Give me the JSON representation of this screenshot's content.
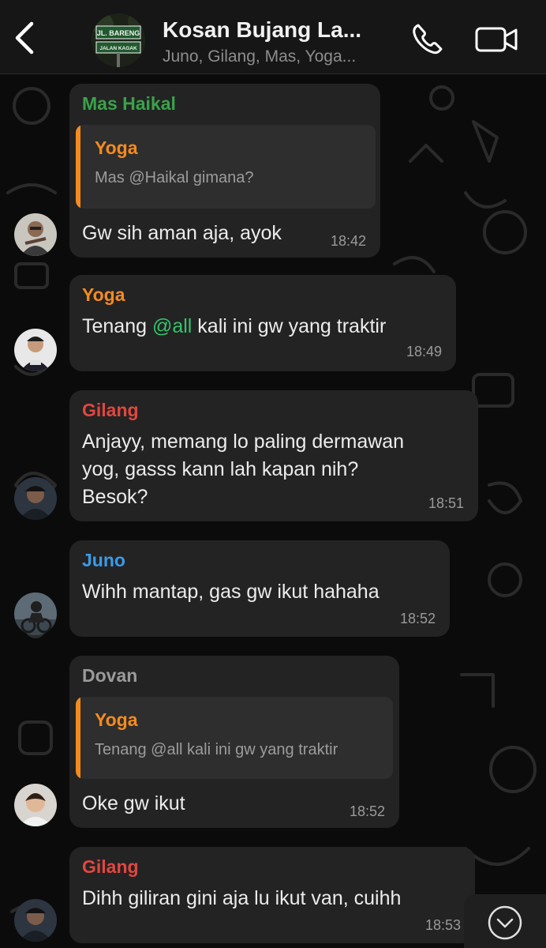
{
  "header": {
    "title": "Kosan Bujang La...",
    "subtitle": "Juno, Gilang, Mas, Yoga...",
    "group_sign_line1": "JL. BARENG",
    "group_sign_line2": "JALAN KAGAK"
  },
  "colors": {
    "mas_haikal": "#3aa24a",
    "yoga": "#f58b1f",
    "gilang": "#e2463f",
    "juno": "#3b9be8",
    "dovan": "#9a9a9a",
    "mention": "#35c36b",
    "bubble": "#232323"
  },
  "messages": [
    {
      "sender": "Mas Haikal",
      "quote": {
        "sender": "Yoga",
        "text": "Mas @Haikal gimana?"
      },
      "lines": [
        "Gw sih aman aja, ayok"
      ],
      "time": "18:42"
    },
    {
      "sender": "Yoga",
      "lines_parts": {
        "before": "Tenang ",
        "mention": "@all",
        "after": " kali ini gw yang traktir"
      },
      "time": "18:49"
    },
    {
      "sender": "Gilang",
      "lines": [
        "Anjayy, memang lo paling dermawan",
        "yog, gasss kann lah kapan nih?",
        "Besok?"
      ],
      "time": "18:51"
    },
    {
      "sender": "Juno",
      "lines": [
        "Wihh mantap, gas gw ikut hahaha"
      ],
      "time": "18:52"
    },
    {
      "sender": "Dovan",
      "quote": {
        "sender": "Yoga",
        "text": "Tenang @all kali ini gw yang traktir"
      },
      "lines": [
        "Oke gw ikut"
      ],
      "time": "18:52"
    },
    {
      "sender": "Gilang",
      "lines": [
        "Dihh giliran gini aja lu ikut van, cuihh"
      ],
      "time": "18:53"
    }
  ]
}
